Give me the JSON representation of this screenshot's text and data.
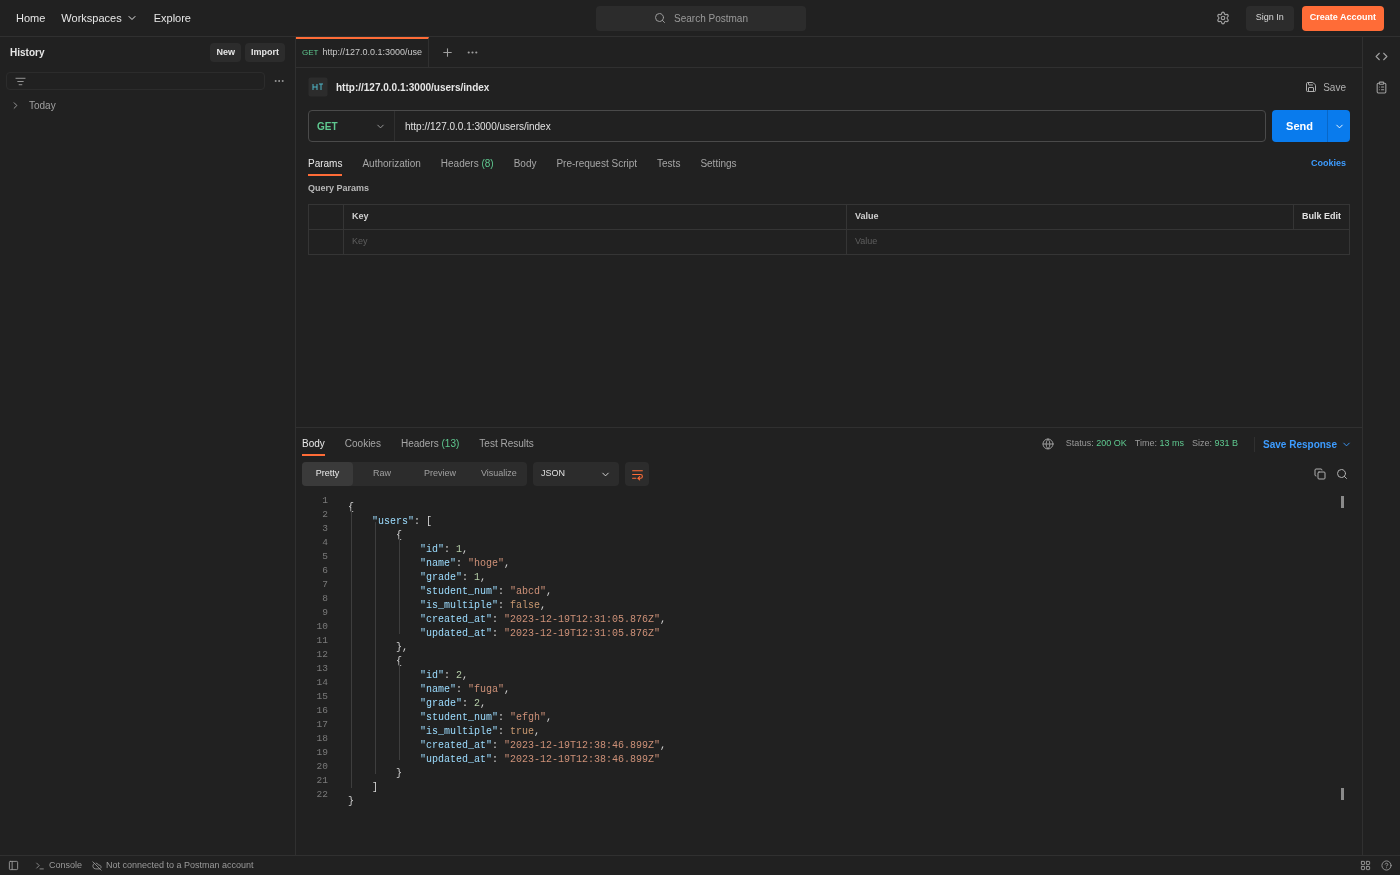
{
  "topbar": {
    "nav": [
      {
        "label": "Home",
        "dropdown": false
      },
      {
        "label": "Workspaces",
        "dropdown": true
      },
      {
        "label": "Explore",
        "dropdown": false
      }
    ],
    "search": {
      "placeholder": "Search Postman"
    },
    "sign_in": "Sign In",
    "create_account": "Create Account"
  },
  "sidebar": {
    "title": "History",
    "buttons": [
      "New",
      "Import"
    ],
    "groups": [
      {
        "label": "Today",
        "expanded": false
      }
    ]
  },
  "tabs": [
    {
      "method": "GET",
      "label": "http://127.0.0.1:3000/use",
      "selected": true
    }
  ],
  "request": {
    "title": "http://127.0.0.1:3000/users/index",
    "save": "Save",
    "method": "GET",
    "url": "http://127.0.0.1:3000/users/index",
    "send": "Send",
    "tabs": [
      {
        "label": "Params",
        "selected": true
      },
      {
        "label": "Authorization",
        "selected": false
      },
      {
        "label": "Headers",
        "count": "(8)",
        "selected": false
      },
      {
        "label": "Body",
        "selected": false
      },
      {
        "label": "Pre-request Script",
        "selected": false
      },
      {
        "label": "Tests",
        "selected": false
      },
      {
        "label": "Settings",
        "selected": false
      }
    ],
    "cookies": "Cookies",
    "query_title": "Query Params",
    "columns": [
      "Key",
      "Value"
    ],
    "bulk_edit": "Bulk Edit",
    "row_placeholders": [
      "Key",
      "Value"
    ]
  },
  "response": {
    "tabs": [
      {
        "label": "Body",
        "selected": true
      },
      {
        "label": "Cookies",
        "selected": false
      },
      {
        "label": "Headers",
        "count": "(13)",
        "selected": false
      },
      {
        "label": "Test Results",
        "selected": false
      }
    ],
    "status_label": "Status:",
    "status": "200 OK",
    "time_label": "Time:",
    "time": "13 ms",
    "size_label": "Size:",
    "size": "931 B",
    "save_response": "Save Response",
    "views": [
      {
        "label": "Pretty",
        "selected": true
      },
      {
        "label": "Raw",
        "selected": false
      },
      {
        "label": "Preview",
        "selected": false
      },
      {
        "label": "Visualize",
        "selected": false
      }
    ],
    "format": "JSON",
    "lines": [
      {
        "number": "1",
        "tokens": [
          {
            "kind": "punct",
            "text": "{"
          }
        ]
      },
      {
        "number": "2",
        "tokens": [
          {
            "kind": "key",
            "text": "    \"users\""
          },
          {
            "kind": "punct",
            "text": ": ["
          }
        ]
      },
      {
        "number": "3",
        "tokens": [
          {
            "kind": "punct",
            "text": "        {"
          }
        ]
      },
      {
        "number": "4",
        "tokens": [
          {
            "kind": "key",
            "text": "            \"id\""
          },
          {
            "kind": "punct",
            "text": ": "
          },
          {
            "kind": "number",
            "text": "1"
          },
          {
            "kind": "punct",
            "text": ","
          }
        ]
      },
      {
        "number": "5",
        "tokens": [
          {
            "kind": "key",
            "text": "            \"name\""
          },
          {
            "kind": "punct",
            "text": ": "
          },
          {
            "kind": "string",
            "text": "\"hoge\""
          },
          {
            "kind": "punct",
            "text": ","
          }
        ]
      },
      {
        "number": "6",
        "tokens": [
          {
            "kind": "key",
            "text": "            \"grade\""
          },
          {
            "kind": "punct",
            "text": ": "
          },
          {
            "kind": "number",
            "text": "1"
          },
          {
            "kind": "punct",
            "text": ","
          }
        ]
      },
      {
        "number": "7",
        "tokens": [
          {
            "kind": "key",
            "text": "            \"student_num\""
          },
          {
            "kind": "punct",
            "text": ": "
          },
          {
            "kind": "string",
            "text": "\"abcd\""
          },
          {
            "kind": "punct",
            "text": ","
          }
        ]
      },
      {
        "number": "8",
        "tokens": [
          {
            "kind": "key",
            "text": "            \"is_multiple\""
          },
          {
            "kind": "punct",
            "text": ": "
          },
          {
            "kind": "bool",
            "text": "false"
          },
          {
            "kind": "punct",
            "text": ","
          }
        ]
      },
      {
        "number": "9",
        "tokens": [
          {
            "kind": "key",
            "text": "            \"created_at\""
          },
          {
            "kind": "punct",
            "text": ": "
          },
          {
            "kind": "string",
            "text": "\"2023-12-19T12:31:05.876Z\""
          },
          {
            "kind": "punct",
            "text": ","
          }
        ]
      },
      {
        "number": "10",
        "tokens": [
          {
            "kind": "key",
            "text": "            \"updated_at\""
          },
          {
            "kind": "punct",
            "text": ": "
          },
          {
            "kind": "string",
            "text": "\"2023-12-19T12:31:05.876Z\""
          }
        ]
      },
      {
        "number": "11",
        "tokens": [
          {
            "kind": "punct",
            "text": "        },"
          }
        ]
      },
      {
        "number": "12",
        "tokens": [
          {
            "kind": "punct",
            "text": "        {"
          }
        ]
      },
      {
        "number": "13",
        "tokens": [
          {
            "kind": "key",
            "text": "            \"id\""
          },
          {
            "kind": "punct",
            "text": ": "
          },
          {
            "kind": "number",
            "text": "2"
          },
          {
            "kind": "punct",
            "text": ","
          }
        ]
      },
      {
        "number": "14",
        "tokens": [
          {
            "kind": "key",
            "text": "            \"name\""
          },
          {
            "kind": "punct",
            "text": ": "
          },
          {
            "kind": "string",
            "text": "\"fuga\""
          },
          {
            "kind": "punct",
            "text": ","
          }
        ]
      },
      {
        "number": "15",
        "tokens": [
          {
            "kind": "key",
            "text": "            \"grade\""
          },
          {
            "kind": "punct",
            "text": ": "
          },
          {
            "kind": "number",
            "text": "2"
          },
          {
            "kind": "punct",
            "text": ","
          }
        ]
      },
      {
        "number": "16",
        "tokens": [
          {
            "kind": "key",
            "text": "            \"student_num\""
          },
          {
            "kind": "punct",
            "text": ": "
          },
          {
            "kind": "string",
            "text": "\"efgh\""
          },
          {
            "kind": "punct",
            "text": ","
          }
        ]
      },
      {
        "number": "17",
        "tokens": [
          {
            "kind": "key",
            "text": "            \"is_multiple\""
          },
          {
            "kind": "punct",
            "text": ": "
          },
          {
            "kind": "bool",
            "text": "true"
          },
          {
            "kind": "punct",
            "text": ","
          }
        ]
      },
      {
        "number": "18",
        "tokens": [
          {
            "kind": "key",
            "text": "            \"created_at\""
          },
          {
            "kind": "punct",
            "text": ": "
          },
          {
            "kind": "string",
            "text": "\"2023-12-19T12:38:46.899Z\""
          },
          {
            "kind": "punct",
            "text": ","
          }
        ]
      },
      {
        "number": "19",
        "tokens": [
          {
            "kind": "key",
            "text": "            \"updated_at\""
          },
          {
            "kind": "punct",
            "text": ": "
          },
          {
            "kind": "string",
            "text": "\"2023-12-19T12:38:46.899Z\""
          }
        ]
      },
      {
        "number": "20",
        "tokens": [
          {
            "kind": "punct",
            "text": "        }"
          }
        ]
      },
      {
        "number": "21",
        "tokens": [
          {
            "kind": "punct",
            "text": "    ]"
          }
        ]
      },
      {
        "number": "22",
        "tokens": [
          {
            "kind": "punct",
            "text": "}"
          }
        ]
      }
    ]
  },
  "status_bar": {
    "console": "Console",
    "connection": "Not connected to a Postman account"
  }
}
